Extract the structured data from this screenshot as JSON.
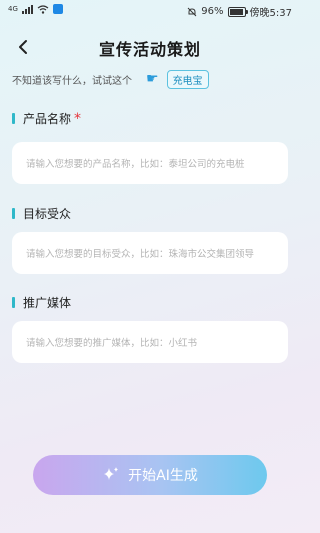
{
  "status": {
    "network": "4G",
    "battery": "96%",
    "battery_level": 0.96,
    "time": "傍晚5:37"
  },
  "header": {
    "title": "宣传活动策划"
  },
  "hint": {
    "text": "不知道该写什么，试试这个",
    "example_chip": "充电宝"
  },
  "fields": {
    "product": {
      "label": "产品名称",
      "required_mark": "*",
      "placeholder": "请输入您想要的产品名称，比如：泰坦公司的充电桩"
    },
    "audience": {
      "label": "目标受众",
      "placeholder": "请输入您想要的目标受众，比如：珠海市公交集团领导"
    },
    "media": {
      "label": "推广媒体",
      "placeholder": "请输入您想要的推广媒体，比如：小红书"
    }
  },
  "actions": {
    "start_label": "开始AI生成"
  },
  "colors": {
    "accent": "#2fb8c9",
    "required": "#e5343a",
    "button_start": "#c9a6ee",
    "button_end": "#6dc9ee"
  }
}
